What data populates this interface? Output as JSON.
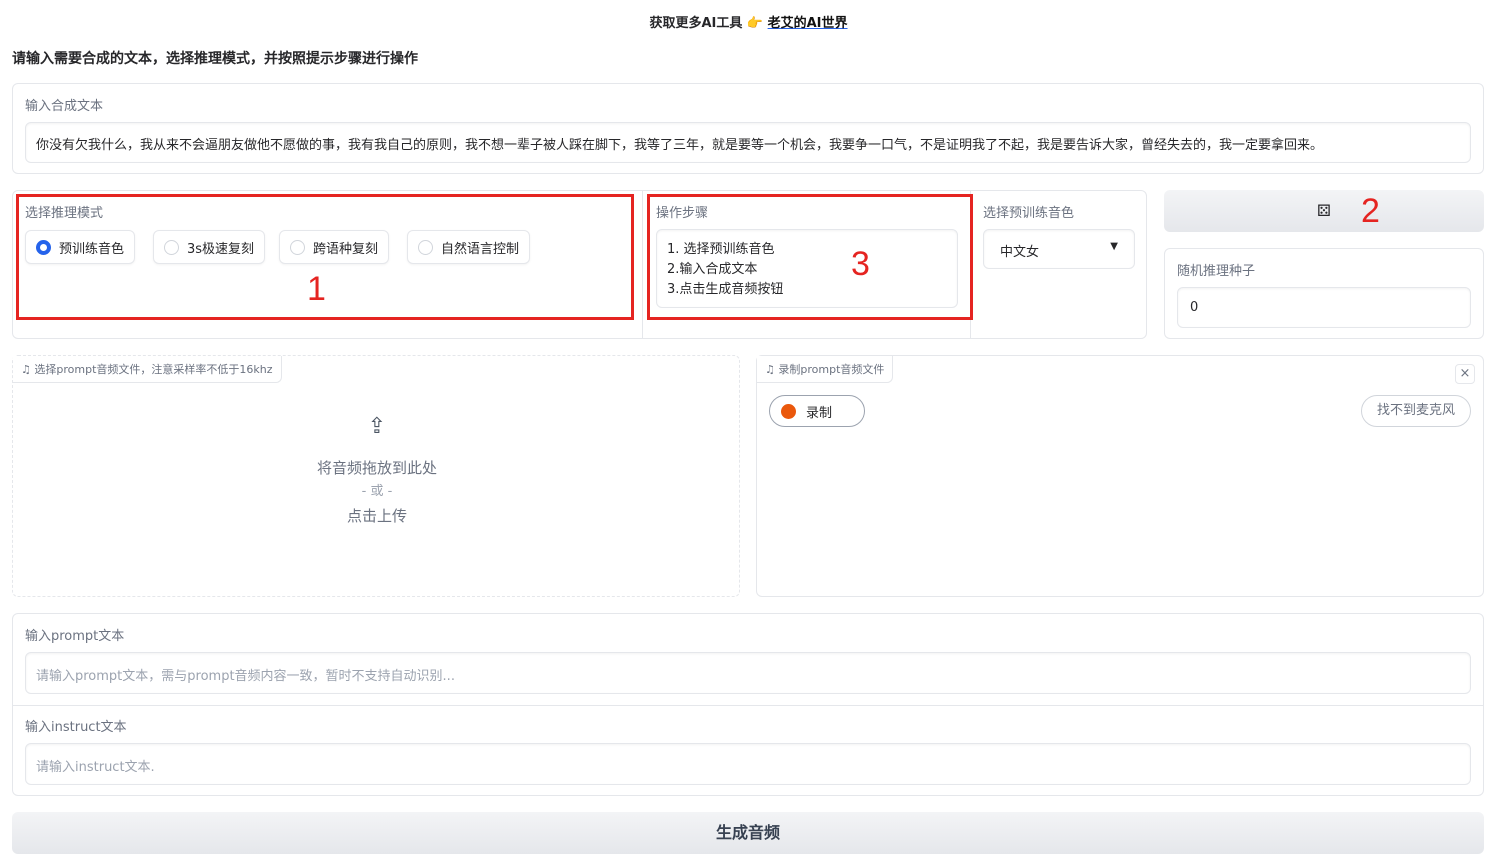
{
  "header": {
    "promo": "获取更多AI工具",
    "link": "老艾的AI世界",
    "instruction": "请输入需要合成的文本，选择推理模式，并按照提示步骤进行操作"
  },
  "tts_text": {
    "label": "输入合成文本",
    "value": "你没有欠我什么，我从来不会逼朋友做他不愿做的事，我有我自己的原则，我不想一辈子被人踩在脚下，我等了三年，就是要等一个机会，我要争一口气，不是证明我了不起，我是要告诉大家，曾经失去的，我一定要拿回来。"
  },
  "mode": {
    "label": "选择推理模式",
    "options": [
      "预训练音色",
      "3s极速复刻",
      "跨语种复刻",
      "自然语言控制"
    ],
    "selected": 0
  },
  "steps": {
    "label": "操作步骤",
    "lines": [
      "1. 选择预训练音色",
      "2.输入合成文本",
      "3.点击生成音频按钮"
    ]
  },
  "voice": {
    "label": "选择预训练音色",
    "value": "中文女"
  },
  "seed": {
    "dice_icon": "dice-icon",
    "label": "随机推理种子",
    "value": "0"
  },
  "annotations": [
    "1",
    "2",
    "3"
  ],
  "upload": {
    "label": "选择prompt音频文件，注意采样率不低于16khz",
    "drop": "将音频拖放到此处",
    "or": "- 或 -",
    "click": "点击上传"
  },
  "record": {
    "label": "录制prompt音频文件",
    "button": "录制",
    "mic": "找不到麦克风",
    "close": "×"
  },
  "prompt_text": {
    "label": "输入prompt文本",
    "placeholder": "请输入prompt文本，需与prompt音频内容一致，暂时不支持自动识别..."
  },
  "instruct_text": {
    "label": "输入instruct文本",
    "placeholder": "请输入instruct文本."
  },
  "generate": "生成音频",
  "colors": {
    "accent": "#2563eb",
    "annotation": "#e52421",
    "record": "#ea580c"
  }
}
